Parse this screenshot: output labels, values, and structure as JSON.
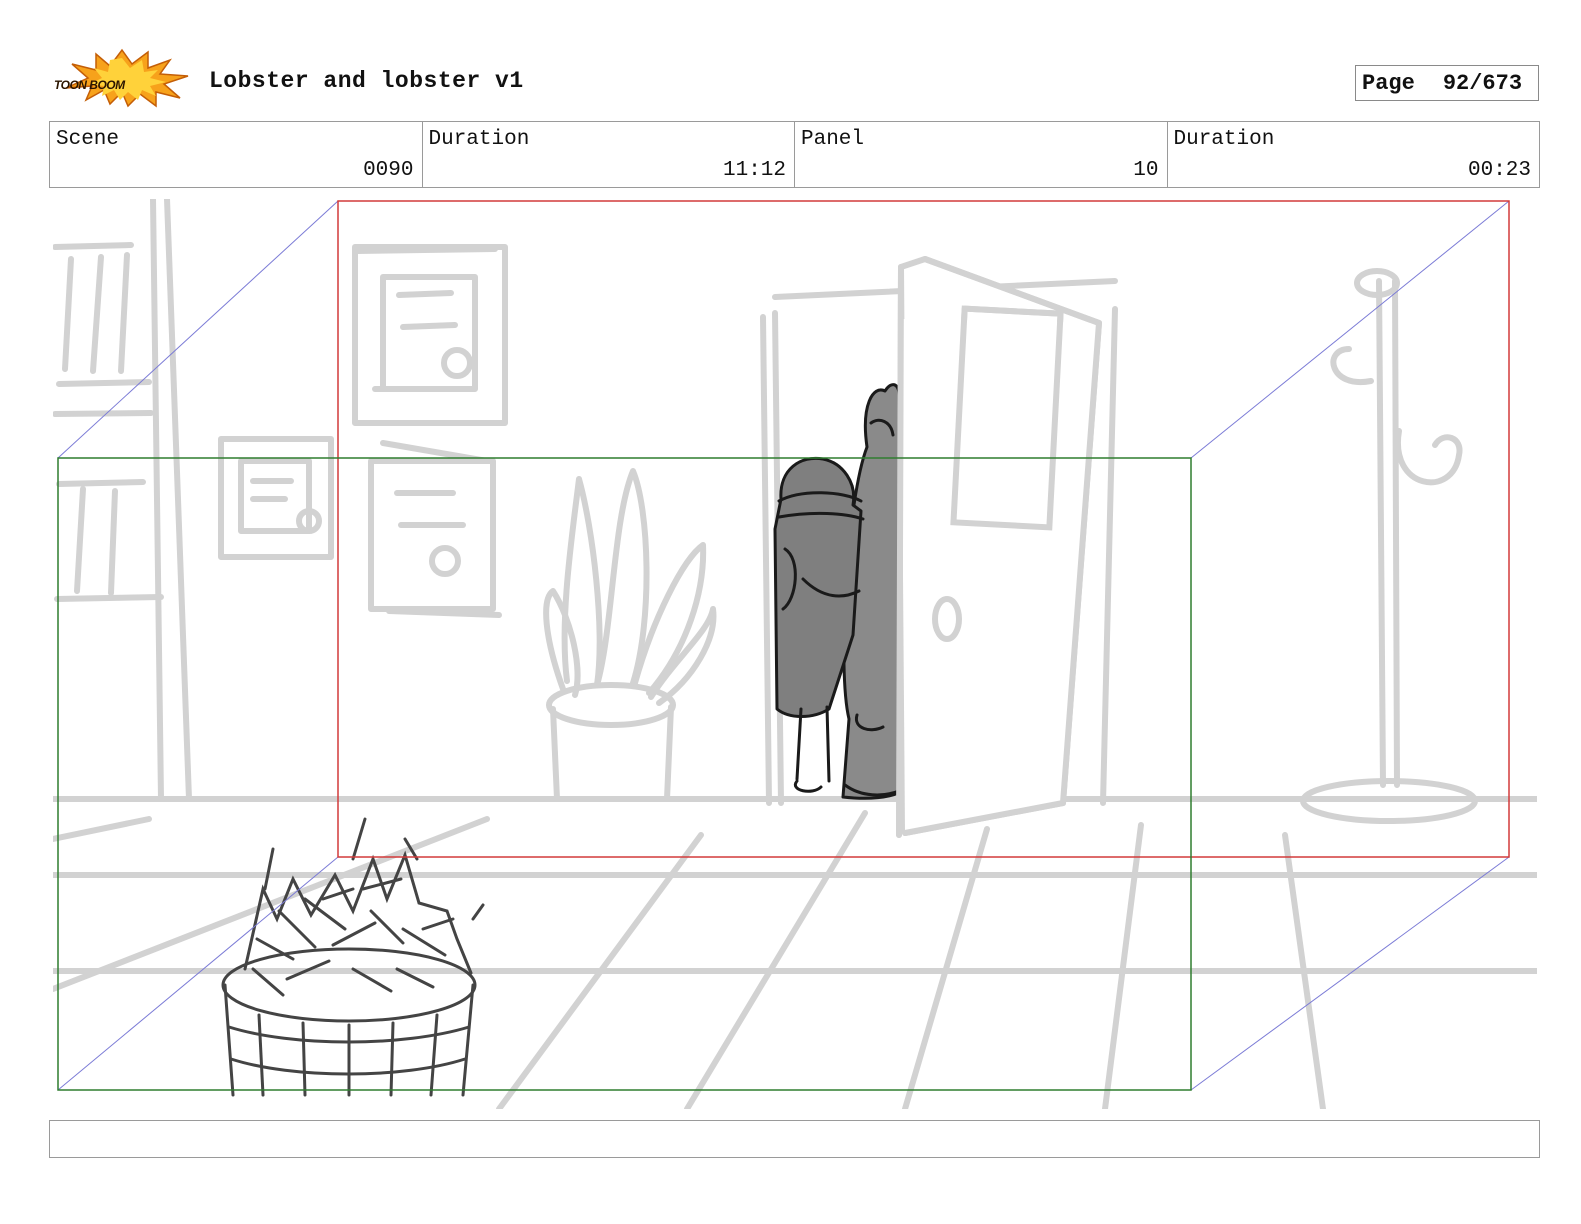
{
  "logo": {
    "text": "TOON BOOM",
    "icon": "toon-boom-burst-logo"
  },
  "header": {
    "project_title": "Lobster and lobster v1"
  },
  "page": {
    "label": "Page",
    "value": "92/673"
  },
  "info": {
    "scene_label": "Scene",
    "scene_value": "0090",
    "scene_duration_label": "Duration",
    "scene_duration_value": "11:12",
    "panel_label": "Panel",
    "panel_value": "10",
    "panel_duration_label": "Duration",
    "panel_duration_value": "00:23"
  },
  "notes": {
    "text": ""
  },
  "colors": {
    "camera_frame_start": "#d23a3a",
    "camera_frame_end": "#2f7d2f",
    "camera_path": "#7b7bd6",
    "background_sketch": "#cfcfcf",
    "character_fill": "#8a8a8a"
  }
}
